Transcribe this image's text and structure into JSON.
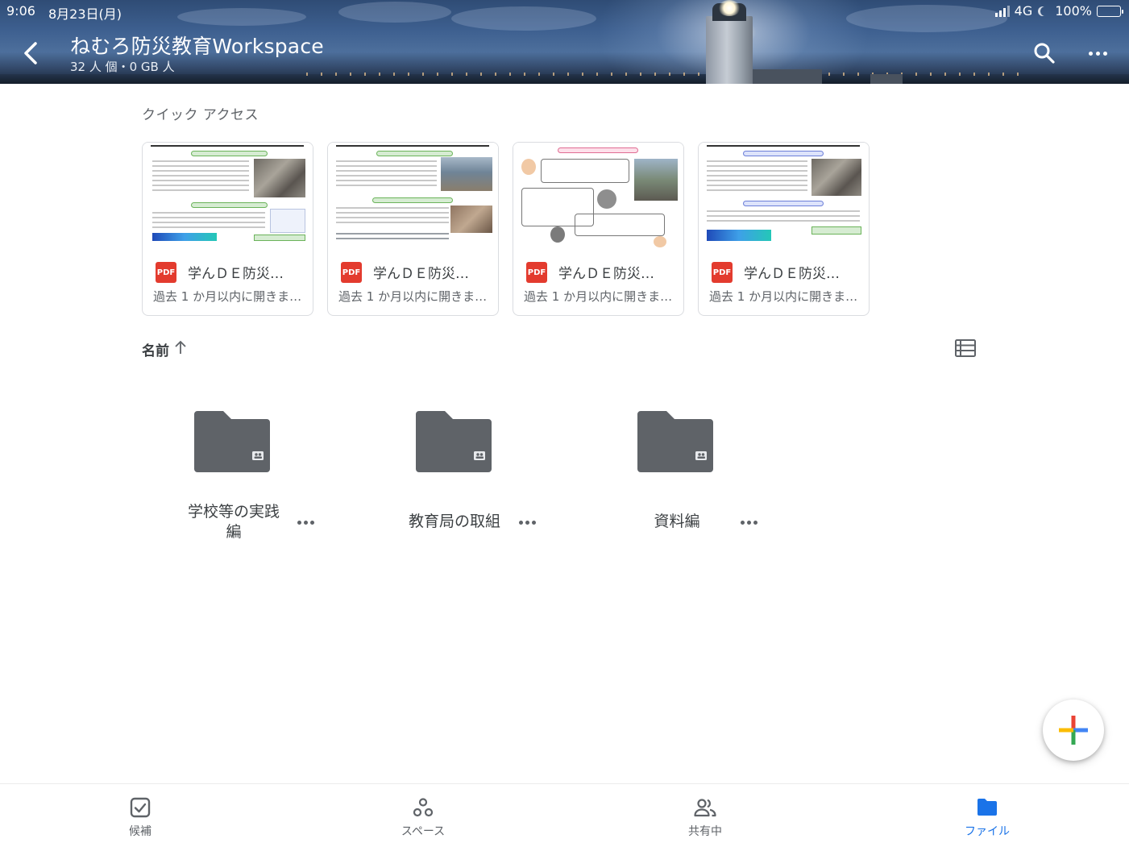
{
  "status_bar": {
    "time": "9:06",
    "date": "8月23日(月)",
    "network": "4G",
    "battery": "100%"
  },
  "header": {
    "title": "ねむろ防災教育Workspace",
    "subtitle": "32 人 個・0 GB 人",
    "icons": {
      "back": "chevron-left-icon",
      "search": "search-icon",
      "more": "more-horizontal-icon"
    }
  },
  "quick_access": {
    "label": "クイック アクセス",
    "items": [
      {
        "name": "学んＤＥ防災…",
        "file_type": "PDF",
        "subtitle": "過去 1 か月以内に開きま…"
      },
      {
        "name": "学んＤＥ防災…",
        "file_type": "PDF",
        "subtitle": "過去 1 か月以内に開きま…"
      },
      {
        "name": "学んＤＥ防災…",
        "file_type": "PDF",
        "subtitle": "過去 1 か月以内に開きま…"
      },
      {
        "name": "学んＤＥ防災…",
        "file_type": "PDF",
        "subtitle": "過去 1 か月以内に開きま…"
      }
    ]
  },
  "sort": {
    "label": "名前",
    "direction_icon": "arrow-up-icon",
    "view_toggle_icon": "list-view-icon"
  },
  "folders": [
    {
      "name": "学校等の実践編",
      "line1": "学校等の実践",
      "line2": "編",
      "icon": "shared-folder-icon"
    },
    {
      "name": "教育局の取組",
      "icon": "shared-folder-icon"
    },
    {
      "name": "資料編",
      "icon": "shared-folder-icon"
    }
  ],
  "fab": {
    "icon": "plus-icon",
    "colors": [
      "#ea4335",
      "#4285f4",
      "#34a853",
      "#fbbc04"
    ]
  },
  "bottom_nav": [
    {
      "label": "候補",
      "icon": "suggested-checkbox-icon",
      "active": false
    },
    {
      "label": "スペース",
      "icon": "spaces-icon",
      "active": false
    },
    {
      "label": "共有中",
      "icon": "shared-people-icon",
      "active": false
    },
    {
      "label": "ファイル",
      "icon": "files-folder-icon",
      "active": true
    }
  ],
  "colors": {
    "accent": "#1a73e8",
    "pdf_red": "#e33b2e",
    "folder_gray": "#5f6368"
  }
}
